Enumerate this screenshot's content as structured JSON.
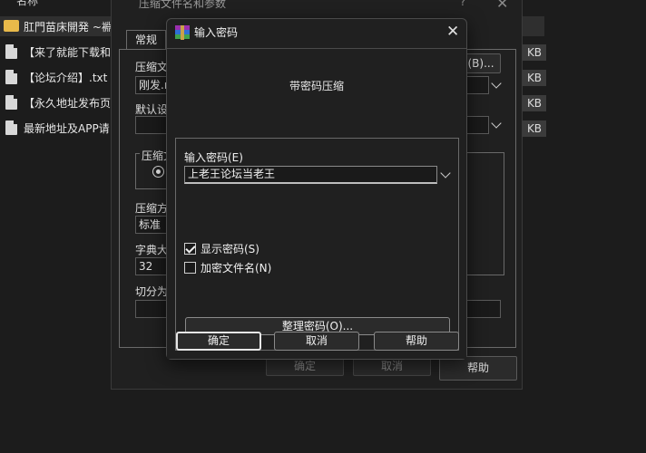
{
  "file_list": {
    "header_label": "名称",
    "rows": [
      {
        "name": "肛門苗床開発 ~裫",
        "size": "",
        "type": "folder"
      },
      {
        "name": "【来了就能下载和",
        "size": "KB",
        "type": "file"
      },
      {
        "name": "【论坛介绍】.txt",
        "size": "KB",
        "type": "file"
      },
      {
        "name": "【永久地址发布页",
        "size": "KB",
        "type": "file"
      },
      {
        "name": "最新地址及APP请",
        "size": "KB",
        "type": "file"
      }
    ]
  },
  "parent_dialog": {
    "title": "压缩文件名和参数",
    "help_glyph": "?",
    "close_glyph": "✕",
    "tab_general": "常规",
    "archive_name_label": "压缩文",
    "archive_name_value": "刚发.r",
    "browse_button": "(B)...",
    "default_settings_label": "默认设",
    "archive_format_label": "压缩文",
    "archive_format_radio": "R",
    "method_label": "压缩方",
    "method_value": "标准",
    "dict_label": "字典大",
    "dict_value": "32",
    "split_label": "切分为",
    "ok_button": "确定",
    "cancel_button": "取消",
    "help_button": "帮助"
  },
  "password_dialog": {
    "title": "输入密码",
    "close_glyph": "✕",
    "heading": "带密码压缩",
    "password_label": "输入密码(E)",
    "password_value": "上老王论坛当老王",
    "show_password_label": "显示密码(S)",
    "show_password_checked": true,
    "encrypt_names_label": "加密文件名(N)",
    "encrypt_names_checked": false,
    "organize_button": "整理密码(O)...",
    "ok_button": "确定",
    "cancel_button": "取消",
    "help_button": "帮助"
  }
}
